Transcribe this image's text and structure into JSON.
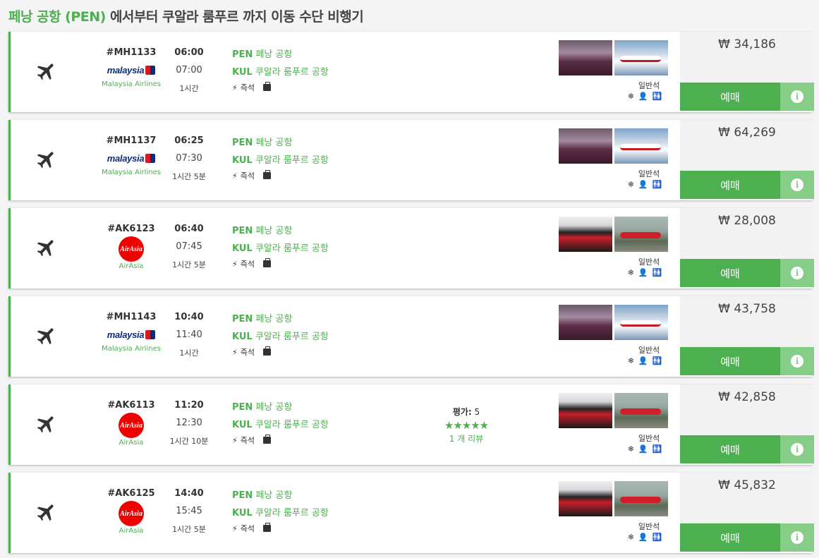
{
  "page": {
    "title_highlight": "페낭 공항 (PEN)",
    "title_rest": " 에서부터 쿠알라 룸푸르 까지 이동 수단 비행기"
  },
  "colors": {
    "accent": "#4cb050",
    "accent_light": "#86ce88",
    "price_bg": "#f2f2f2"
  },
  "icons": {
    "transport": "airplane-icon",
    "instant": "bolt-icon",
    "baggage": "briefcase-icon",
    "amenities": [
      "snowflake-icon",
      "seat-icon",
      "restroom-icon"
    ],
    "info": "info-icon"
  },
  "flights": [
    {
      "code": "#MH1133",
      "airline": "Malaysia Airlines",
      "logo": "malaysia",
      "depart": "06:00",
      "arrive": "07:00",
      "duration": "1시간",
      "from_code": "PEN",
      "from_name": "페낭 공항",
      "to_code": "KUL",
      "to_name": "쿠알라 룸푸르 공항",
      "instant_label": "즉석",
      "class": "일반석",
      "price": "₩ 34,186",
      "book_label": "예매",
      "rating": null
    },
    {
      "code": "#MH1137",
      "airline": "Malaysia Airlines",
      "logo": "malaysia",
      "depart": "06:25",
      "arrive": "07:30",
      "duration": "1시간 5분",
      "from_code": "PEN",
      "from_name": "페낭 공항",
      "to_code": "KUL",
      "to_name": "쿠알라 룸푸르 공항",
      "instant_label": "즉석",
      "class": "일반석",
      "price": "₩ 64,269",
      "book_label": "예매",
      "rating": null
    },
    {
      "code": "#AK6123",
      "airline": "AirAsia",
      "logo": "airasia",
      "depart": "06:40",
      "arrive": "07:45",
      "duration": "1시간 5분",
      "from_code": "PEN",
      "from_name": "페낭 공항",
      "to_code": "KUL",
      "to_name": "쿠알라 룸푸르 공항",
      "instant_label": "즉석",
      "class": "일반석",
      "price": "₩ 28,008",
      "book_label": "예매",
      "rating": null
    },
    {
      "code": "#MH1143",
      "airline": "Malaysia Airlines",
      "logo": "malaysia",
      "depart": "10:40",
      "arrive": "11:40",
      "duration": "1시간",
      "from_code": "PEN",
      "from_name": "페낭 공항",
      "to_code": "KUL",
      "to_name": "쿠알라 룸푸르 공항",
      "instant_label": "즉석",
      "class": "일반석",
      "price": "₩ 43,758",
      "book_label": "예매",
      "rating": null
    },
    {
      "code": "#AK6113",
      "airline": "AirAsia",
      "logo": "airasia",
      "depart": "11:20",
      "arrive": "12:30",
      "duration": "1시간 10분",
      "from_code": "PEN",
      "from_name": "페낭 공항",
      "to_code": "KUL",
      "to_name": "쿠알라 룸푸르 공항",
      "instant_label": "즉석",
      "class": "일반석",
      "price": "₩ 42,858",
      "book_label": "예매",
      "rating": {
        "label": "평가:",
        "value": "5",
        "stars": "★★★★★",
        "reviews": "1 개 리뷰"
      }
    },
    {
      "code": "#AK6125",
      "airline": "AirAsia",
      "logo": "airasia",
      "depart": "14:40",
      "arrive": "15:45",
      "duration": "1시간 5분",
      "from_code": "PEN",
      "from_name": "페낭 공항",
      "to_code": "KUL",
      "to_name": "쿠알라 룸푸르 공항",
      "instant_label": "즉석",
      "class": "일반석",
      "price": "₩ 45,832",
      "book_label": "예매",
      "rating": null
    }
  ],
  "logos": {
    "malaysia_text": "malaysia",
    "airasia_text": "AirAsia"
  }
}
